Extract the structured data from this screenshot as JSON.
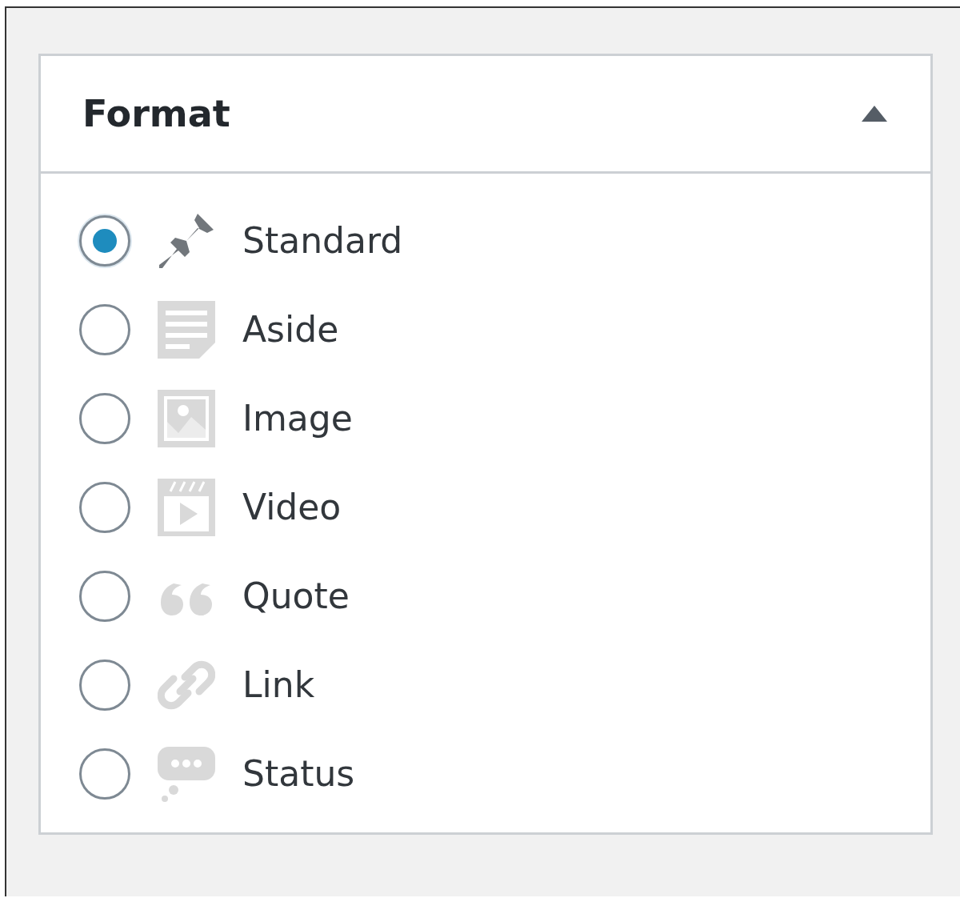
{
  "panel": {
    "title": "Format",
    "expanded": true
  },
  "formats": [
    {
      "label": "Standard",
      "selected": true
    },
    {
      "label": "Aside",
      "selected": false
    },
    {
      "label": "Image",
      "selected": false
    },
    {
      "label": "Video",
      "selected": false
    },
    {
      "label": "Quote",
      "selected": false
    },
    {
      "label": "Link",
      "selected": false
    },
    {
      "label": "Status",
      "selected": false
    }
  ]
}
